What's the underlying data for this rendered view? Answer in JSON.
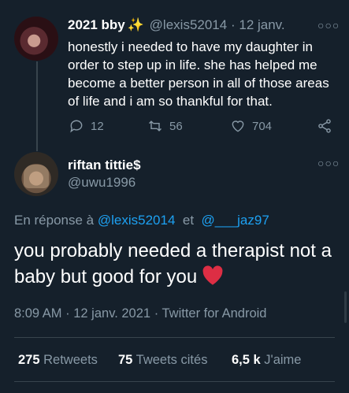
{
  "parent_tweet": {
    "display_name": "2021 bby",
    "badge_icon": "sparkles-icon",
    "handle": "@lexis52014",
    "separator": "·",
    "date": "12 janv.",
    "text": "honestly i needed to have my daughter in order to step up in life. she has helped me become a better person in all of those areas of life and i am so thankful for that.",
    "replies": "12",
    "retweets": "56",
    "likes": "704"
  },
  "reply_tweet": {
    "display_name": "riftan tittie$",
    "handle": "@uwu1996",
    "reply_prefix": "En réponse à",
    "reply_to_1": "@lexis52014",
    "reply_joiner": "et",
    "reply_to_2": "@___jaz97",
    "text": "you probably needed a therapist not a baby but good for you",
    "emoji": "red-heart-icon",
    "time": "8:09 AM",
    "sep1": "·",
    "date": "12 janv. 2021",
    "sep2": "·",
    "client": "Twitter for Android",
    "stats": {
      "retweets_count": "275",
      "retweets_label": "Retweets",
      "quotes_count": "75",
      "quotes_label": "Tweets cités",
      "likes_count": "6,5 k",
      "likes_label": "J'aime"
    }
  },
  "colors": {
    "background": "#15202b",
    "text": "#ffffff",
    "muted": "#8899a6",
    "link": "#1da1f2",
    "divider": "#38444d",
    "heart": "#e0245e"
  }
}
